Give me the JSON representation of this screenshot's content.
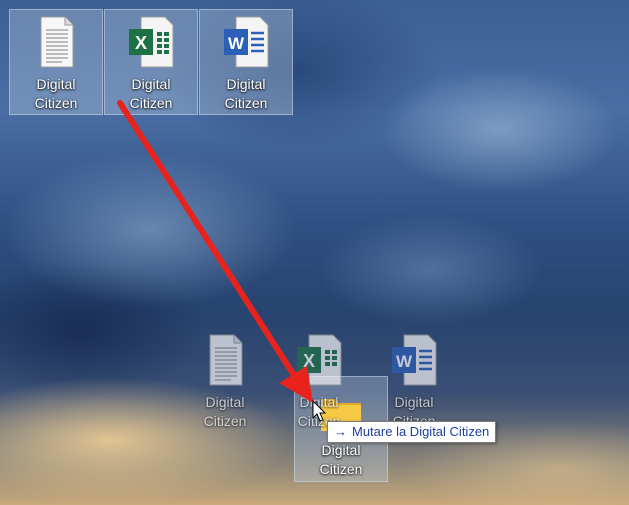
{
  "desktop": {
    "icons": [
      {
        "label_line1": "Digital",
        "label_line2": "Citizen",
        "type": "text-file-icon"
      },
      {
        "label_line1": "Digital",
        "label_line2": "Citizen",
        "type": "excel-file-icon"
      },
      {
        "label_line1": "Digital",
        "label_line2": "Citizen",
        "type": "word-file-icon"
      }
    ],
    "drag_ghosts": [
      {
        "label_line1": "Digital",
        "label_line2": "Citizen",
        "type": "text-file-icon"
      },
      {
        "label_line1": "Digital",
        "label_line2": "Citizen",
        "type": "excel-file-icon"
      },
      {
        "label_line1": "Digital",
        "label_line2": "Citizen",
        "type": "word-file-icon"
      }
    ],
    "drop_target_folder": {
      "label_line1": "Digital",
      "label_line2": "Citizen",
      "type": "folder-icon"
    }
  },
  "tooltip": {
    "arrow": "→",
    "text": "Mutare la Digital Citizen"
  },
  "colors": {
    "annotation_arrow": "#e8231d",
    "excel_green": "#1e7145",
    "word_blue": "#2b5fb8",
    "folder_yellow": "#f6c945",
    "tooltip_text": "#1a3fa0"
  }
}
